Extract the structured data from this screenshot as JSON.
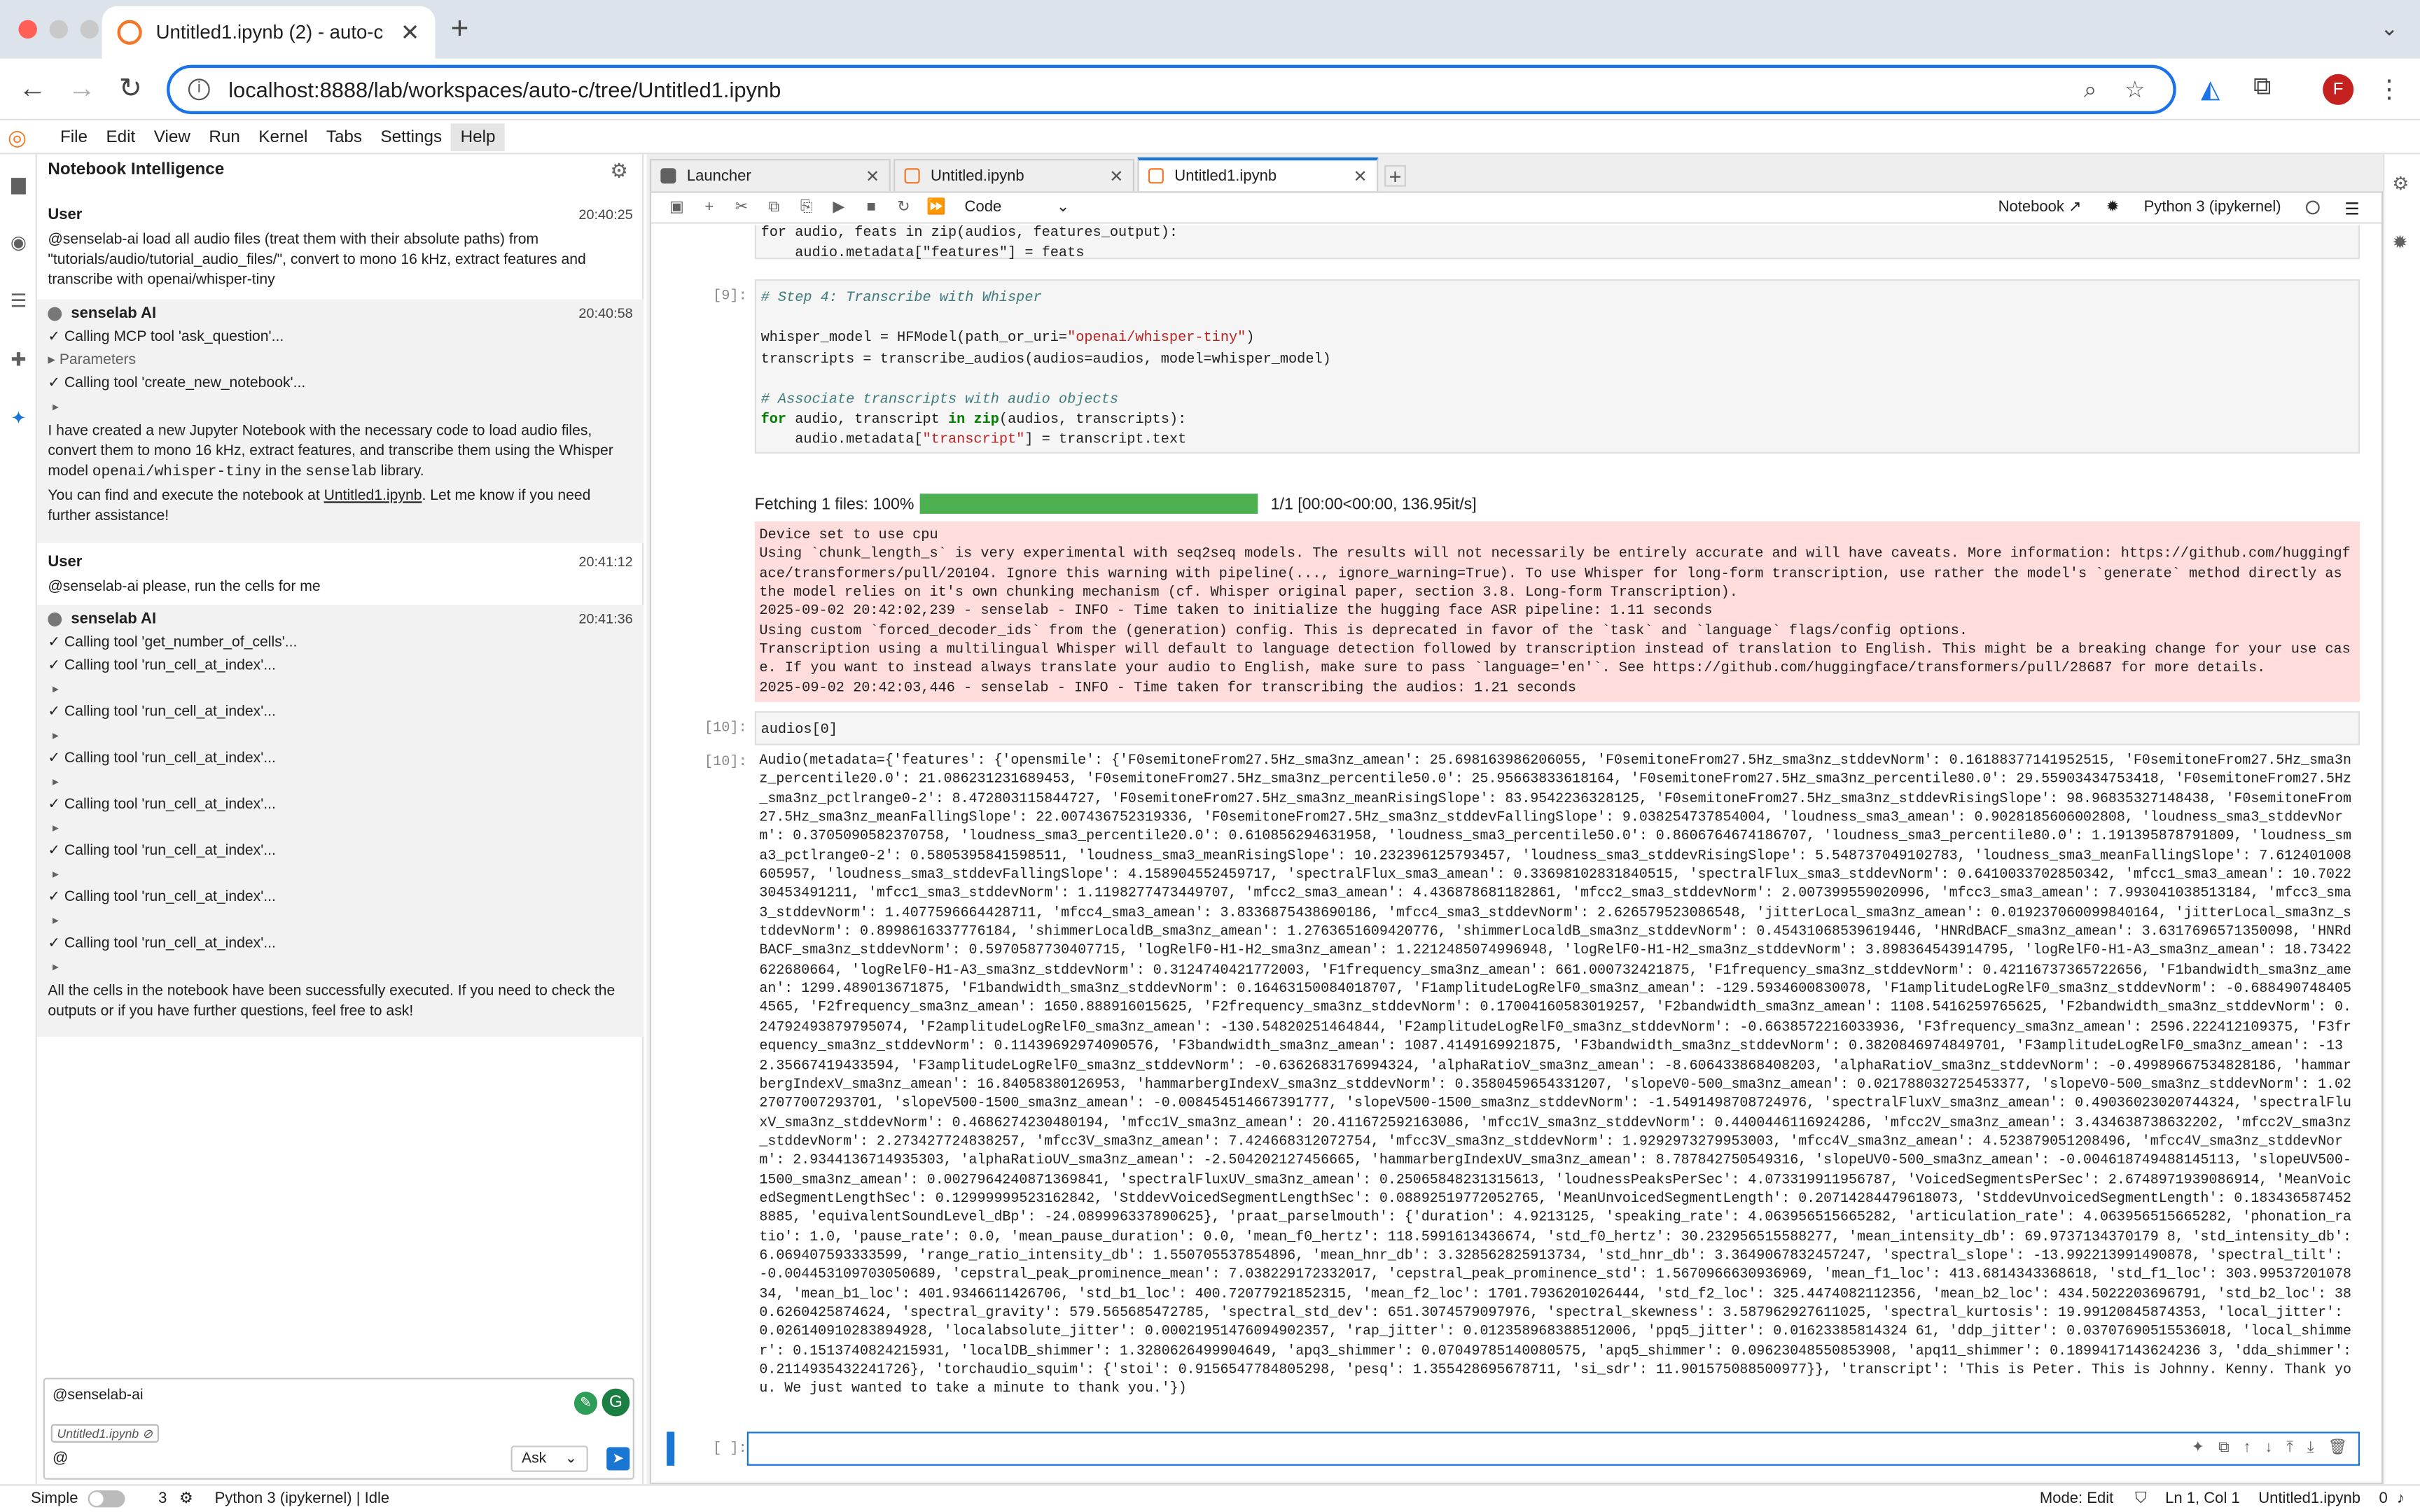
{
  "browser": {
    "tab_title": "Untitled1.ipynb (2) - auto-c",
    "url": "localhost:8888/lab/workspaces/auto-c/tree/Untitled1.ipynb",
    "avatar_letter": "F"
  },
  "menu": [
    "File",
    "Edit",
    "View",
    "Run",
    "Kernel",
    "Tabs",
    "Settings",
    "Help"
  ],
  "chat": {
    "title": "Notebook Intelligence",
    "m1_who": "User",
    "m1_time": "20:40:25",
    "m1_text": "@senselab-ai load all audio files (treat them with their absolute paths) from \"tutorials/audio/tutorial_audio_files/\", convert to mono 16 kHz, extract features and transcribe with openai/whisper-tiny",
    "m2_who": "senselab AI",
    "m2_time": "20:40:58",
    "m2_step1": "✓ Calling MCP tool 'ask_question'...",
    "m2_params": "Parameters",
    "m2_step2": "✓ Calling tool 'create_new_notebook'...",
    "m2_p1a": "I have created a new Jupyter Notebook with the necessary code to load audio files, convert them to mono 16 kHz, extract features, and transcribe them using the Whisper model ",
    "m2_p1code": "openai/whisper-tiny",
    "m2_p1b": " in the ",
    "m2_p1code2": "senselab",
    "m2_p1c": " library.",
    "m2_p2a": "You can find and execute the notebook at ",
    "m2_p2link": "Untitled1.ipynb",
    "m2_p2b": ". Let me know if you need further assistance!",
    "m3_who": "User",
    "m3_time": "20:41:12",
    "m3_text": "@senselab-ai please, run the cells for me",
    "m4_who": "senselab AI",
    "m4_time": "20:41:36",
    "m4_steps": [
      "✓ Calling tool 'get_number_of_cells'...",
      "✓ Calling tool 'run_cell_at_index'...",
      "✓ Calling tool 'run_cell_at_index'...",
      "✓ Calling tool 'run_cell_at_index'...",
      "✓ Calling tool 'run_cell_at_index'...",
      "✓ Calling tool 'run_cell_at_index'...",
      "✓ Calling tool 'run_cell_at_index'...",
      "✓ Calling tool 'run_cell_at_index'..."
    ],
    "m4_text": "All the cells in the notebook have been successfully executed. If you need to check the outputs or if you have further questions, feel free to ask!",
    "input_text": "@senselab-ai",
    "context_chip": "Untitled1.ipynb",
    "at": "@",
    "mode": "Ask"
  },
  "tabs": [
    {
      "name": "Launcher"
    },
    {
      "name": "Untitled.ipynb"
    },
    {
      "name": "Untitled1.ipynb"
    }
  ],
  "toolbar": {
    "cell_type": "Code",
    "notebook_label": "Notebook",
    "kernel": "Python 3 (ipykernel)"
  },
  "cells": {
    "top_code": "for audio, feats in zip(audios, features_output):\n    audio.metadata[\"features\"] = feats",
    "c9_prompt": "[9]:",
    "c10_prompt": "[10]:",
    "c10_out_prompt": "[10]:",
    "c10_code": "audios[0]",
    "empty_prompt": "[ ]:",
    "progress_label": "Fetching 1 files: 100%",
    "progress_fraction": 1.0,
    "progress_stats": "1/1 [00:00<00:00, 136.95it/s]",
    "stderr_lines": [
      "Device set to use cpu",
      "Using `chunk_length_s` is very experimental with seq2seq models. The results will not necessarily be entirely accurate and will have caveats. More information: https://github.com/huggingface/transformers/pull/20104. Ignore this warning with pipeline(..., ignore_warning=True). To use Whisper for long-form transcription, use rather the model's `generate` method directly as the model relies on it's own chunking mechanism (cf. Whisper original paper, section 3.8. Long-form Transcription).",
      "2025-09-02 20:42:02,239 - senselab - INFO - Time taken to initialize the hugging face ASR pipeline: 1.11 seconds",
      "Using custom `forced_decoder_ids` from the (generation) config. This is deprecated in favor of the `task` and `language` flags/config options.",
      "Transcription using a multilingual Whisper will default to language detection followed by transcription instead of translation to English. This might be a breaking change for your use case. If you want to instead always translate your audio to English, make sure to pass `language='en'`. See https://github.com/huggingface/transformers/pull/28687 for more details.",
      "2025-09-02 20:42:03,446 - senselab - INFO - Time taken for transcribing the audios: 1.21 seconds"
    ],
    "output_text": "Audio(metadata={'features': {'opensmile': {'F0semitoneFrom27.5Hz_sma3nz_amean': 25.698163986206055, 'F0semitoneFrom27.5Hz_sma3nz_stddevNorm': 0.16188377141952515, 'F0semitoneFrom27.5Hz_sma3nz_percentile20.0': 21.086231231689453, 'F0semitoneFrom27.5Hz_sma3nz_percentile50.0': 25.95663833618164, 'F0semitoneFrom27.5Hz_sma3nz_percentile80.0': 29.55903434753418, 'F0semitoneFrom27.5Hz_sma3nz_pctlrange0-2': 8.472803115844727, 'F0semitoneFrom27.5Hz_sma3nz_meanRisingSlope': 83.9542236328125, 'F0semitoneFrom27.5Hz_sma3nz_stddevRisingSlope': 98.96835327148438, 'F0semitoneFrom27.5Hz_sma3nz_meanFallingSlope': 22.007436752319336, 'F0semitoneFrom27.5Hz_sma3nz_stddevFallingSlope': 9.038254737854004, 'loudness_sma3_amean': 0.9028185606002808, 'loudness_sma3_stddevNorm': 0.3705090582370758, 'loudness_sma3_percentile20.0': 0.610856294631958, 'loudness_sma3_percentile50.0': 0.8606764674186707, 'loudness_sma3_percentile80.0': 1.191395878791809, 'loudness_sma3_pctlrange0-2': 0.5805395841598511, 'loudness_sma3_meanRisingSlope': 10.232396125793457, 'loudness_sma3_stddevRisingSlope': 5.548737049102783, 'loudness_sma3_meanFallingSlope': 7.612401008605957, 'loudness_sma3_stddevFallingSlope': 4.158904552459717, 'spectralFlux_sma3_amean': 0.33698102831840515, 'spectralFlux_sma3_stddevNorm': 0.6410033702850342, 'mfcc1_sma3_amean': 10.702230453491211, 'mfcc1_sma3_stddevNorm': 1.1198277473449707, 'mfcc2_sma3_amean': 4.436878681182861, 'mfcc2_sma3_stddevNorm': 2.007399559020996, 'mfcc3_sma3_amean': 7.993041038513184, 'mfcc3_sma3_stddevNorm': 1.4077596664428711, 'mfcc4_sma3_amean': 3.8336875438690186, 'mfcc4_sma3_stddevNorm': 2.626579523086548, 'jitterLocal_sma3nz_amean': 0.019237060099840164, 'jitterLocal_sma3nz_stddevNorm': 0.8998616337776184, 'shimmerLocaldB_sma3nz_amean': 1.2763651609420776, 'shimmerLocaldB_sma3nz_stddevNorm': 0.45431068539619446, 'HNRdBACF_sma3nz_amean': 3.6317696571350098, 'HNRdBACF_sma3nz_stddevNorm': 0.5970587730407715, 'logRelF0-H1-H2_sma3nz_amean': 1.2212485074996948, 'logRelF0-H1-H2_sma3nz_stddevNorm': 3.898364543914795, 'logRelF0-H1-A3_sma3nz_amean': 18.73422622680664, 'logRelF0-H1-A3_sma3nz_stddevNorm': 0.3124740421772003, 'F1frequency_sma3nz_amean': 661.000732421875, 'F1frequency_sma3nz_stddevNorm': 0.42116737365722656, 'F1bandwidth_sma3nz_amean': 1299.489013671875, 'F1bandwidth_sma3nz_stddevNorm': 0.16463150084018707, 'F1amplitudeLogRelF0_sma3nz_amean': -129.5934600830078, 'F1amplitudeLogRelF0_sma3nz_stddevNorm': -0.6884907484054565, 'F2frequency_sma3nz_amean': 1650.888916015625, 'F2frequency_sma3nz_stddevNorm': 0.17004160583019257, 'F2bandwidth_sma3nz_amean': 1108.5416259765625, 'F2bandwidth_sma3nz_stddevNorm': 0.24792493879795074, 'F2amplitudeLogRelF0_sma3nz_amean': -130.54820251464844, 'F2amplitudeLogRelF0_sma3nz_stddevNorm': -0.6638572216033936, 'F3frequency_sma3nz_amean': 2596.222412109375, 'F3frequency_sma3nz_stddevNorm': 0.11439692974090576, 'F3bandwidth_sma3nz_amean': 1087.4149169921875, 'F3bandwidth_sma3nz_stddevNorm': 0.3820846974849701, 'F3amplitudeLogRelF0_sma3nz_amean': -132.35667419433594, 'F3amplitudeLogRelF0_sma3nz_stddevNorm': -0.6362683176994324, 'alphaRatioV_sma3nz_amean': -8.606433868408203, 'alphaRatioV_sma3nz_stddevNorm': -0.49989667534828186, 'hammarbergIndexV_sma3nz_amean': 16.84058380126953, 'hammarbergIndexV_sma3nz_stddevNorm': 0.3580459654331207, 'slopeV0-500_sma3nz_amean': 0.021788032725453377, 'slopeV0-500_sma3nz_stddevNorm': 1.0227077007293701, 'slopeV500-1500_sma3nz_amean': -0.008454514667391777, 'slopeV500-1500_sma3nz_stddevNorm': -1.5491498708724976, 'spectralFluxV_sma3nz_amean': 0.49036023020744324, 'spectralFluxV_sma3nz_stddevNorm': 0.4686274230480194, 'mfcc1V_sma3nz_amean': 20.411672592163086, 'mfcc1V_sma3nz_stddevNorm': 0.4400446116924286, 'mfcc2V_sma3nz_amean': 3.434638738632202, 'mfcc2V_sma3nz_stddevNorm': 2.273427724838257, 'mfcc3V_sma3nz_amean': 7.424668312072754, 'mfcc3V_sma3nz_stddevNorm': 1.9292973279953003, 'mfcc4V_sma3nz_amean': 4.523879051208496, 'mfcc4V_sma3nz_stddevNorm': 2.9344136714935303, 'alphaRatioUV_sma3nz_amean': -2.504202127456665, 'hammarbergIndexUV_sma3nz_amean': 8.787842750549316, 'slopeUV0-500_sma3nz_amean': -0.004618749488145113, 'slopeUV500-1500_sma3nz_amean': 0.0027964240871369841, 'spectralFluxUV_sma3nz_amean': 0.25065848231315613, 'loudnessPeaksPerSec': 4.073319911956787, 'VoicedSegmentsPerSec': 2.6748971939086914, 'MeanVoicedSegmentLengthSec': 0.12999999523162842, 'StddevVoicedSegmentLengthSec': 0.08892519772052765, 'MeanUnvoicedSegmentLength': 0.20714284479618073, 'StddevUnvoicedSegmentLength': 0.1834365874528885, 'equivalentSoundLevel_dBp': -24.089996337890625}, 'praat_parselmouth': {'duration': 4.9213125, 'speaking_rate': 4.063956515665282, 'articulation_rate': 4.063956515665282, 'phonation_ratio': 1.0, 'pause_rate': 0.0, 'mean_pause_duration': 0.0, 'mean_f0_hertz': 118.5991613436674, 'std_f0_hertz': 30.232956515588277, 'mean_intensity_db': 69.9737134370179 8, 'std_intensity_db': 6.069407593333599, 'range_ratio_intensity_db': 1.550705537854896, 'mean_hnr_db': 3.328562825913734, 'std_hnr_db': 3.3649067832457247, 'spectral_slope': -13.992213991490878, 'spectral_tilt': -0.004453109703050689, 'cepstral_peak_prominence_mean': 7.038229172332017, 'cepstral_peak_prominence_std': 1.5670966630936969, 'mean_f1_loc': 413.6814343368618, 'std_f1_loc': 303.9953720107834, 'mean_b1_loc': 401.9346611426706, 'std_b1_loc': 400.72077921852315, 'mean_f2_loc': 1701.7936201026444, 'std_f2_loc': 325.4474082112356, 'mean_b2_loc': 434.5022203696791, 'std_b2_loc': 380.6260425874624, 'spectral_gravity': 579.565685472785, 'spectral_std_dev': 651.3074579097976, 'spectral_skewness': 3.587962927611025, 'spectral_kurtosis': 19.99120845874353, 'local_jitter': 0.026140910283894928, 'localabsolute_jitter': 0.00021951476094902357, 'rap_jitter': 0.012358968388512006, 'ppq5_jitter': 0.01623385814324 61, 'ddp_jitter': 0.03707690515536018, 'local_shimmer': 0.1513740824215931, 'localDB_shimmer': 1.3280626499904649, 'apq3_shimmer': 0.07049785140080575, 'apq5_shimmer': 0.09623048550853908, 'apq11_shimmer': 0.1899417143624236 3, 'dda_shimmer': 0.2114935432241726}, 'torchaudio_squim': {'stoi': 0.9156547784805298, 'pesq': 1.355428695678711, 'si_sdr': 11.901575088500977}}, 'transcript': 'This is Peter. This is Johnny. Kenny. Thank you. We just wanted to take a minute to thank you.'})"
  },
  "status": {
    "simple": "Simple",
    "count": "3",
    "kernel_status": "Python 3 (ipykernel) | Idle",
    "mode": "Mode: Edit",
    "position": "Ln 1, Col 1",
    "file": "Untitled1.ipynb",
    "notifications": "0"
  }
}
